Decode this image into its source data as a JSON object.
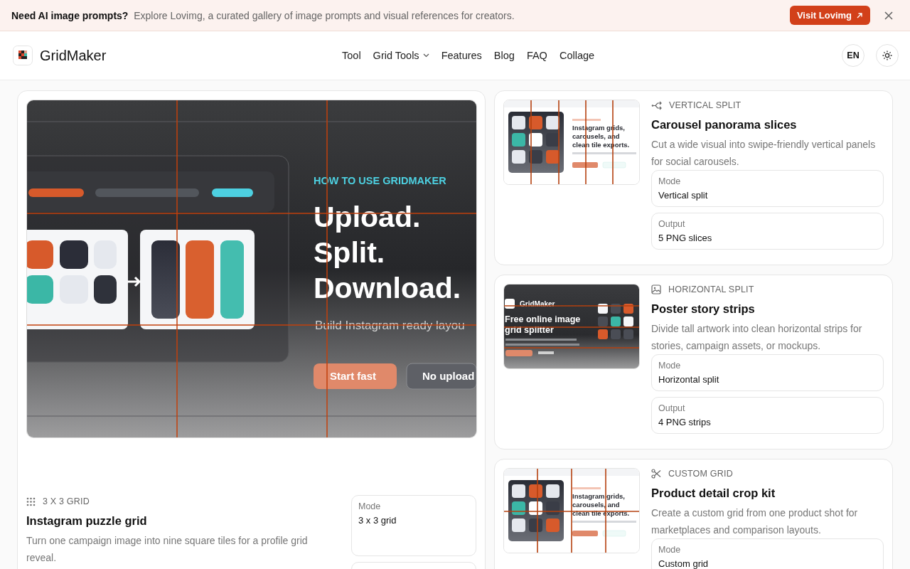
{
  "banner": {
    "title": "Need AI image prompts?",
    "text": "Explore Lovimg, a curated gallery of image prompts and visual references for creators.",
    "button": "Visit Lovimg"
  },
  "header": {
    "brand": "GridMaker",
    "nav": [
      {
        "label": "Tool",
        "dropdown": false
      },
      {
        "label": "Grid Tools",
        "dropdown": true
      },
      {
        "label": "Features",
        "dropdown": false
      },
      {
        "label": "Blog",
        "dropdown": false
      },
      {
        "label": "FAQ",
        "dropdown": false
      },
      {
        "label": "Collage",
        "dropdown": false
      }
    ],
    "language": "EN"
  },
  "featured": {
    "kind": "grid",
    "preview": {
      "eyebrow": "HOW TO USE GRIDMAKER",
      "headline": [
        "Upload.",
        "Split.",
        "Download."
      ],
      "subtitle": "Build Instagram ready layou",
      "buttons": [
        "Start fast",
        "No upload"
      ]
    },
    "category": "3 X 3 GRID",
    "title": "Instagram puzzle grid",
    "description": "Turn one campaign image into nine square tiles for a profile grid reveal.",
    "details": [
      {
        "label": "Mode",
        "value": "3 x 3 grid"
      }
    ]
  },
  "cards": [
    {
      "kind": "vertical",
      "thumbnail": {
        "headline": [
          "Instagram grids,",
          "carousels, and",
          "clean tile exports."
        ]
      },
      "category": "VERTICAL SPLIT",
      "title": "Carousel panorama slices",
      "description": "Cut a wide visual into swipe-friendly vertical panels for social carousels.",
      "details": [
        {
          "label": "Mode",
          "value": "Vertical split"
        },
        {
          "label": "Output",
          "value": "5 PNG slices"
        }
      ]
    },
    {
      "kind": "horizontal",
      "thumbnail": {
        "brand": "GridMaker",
        "headline": [
          "Free online image",
          "grid splitter"
        ]
      },
      "category": "HORIZONTAL SPLIT",
      "title": "Poster story strips",
      "description": "Divide tall artwork into clean horizontal strips for stories, campaign assets, or mockups.",
      "details": [
        {
          "label": "Mode",
          "value": "Horizontal split"
        },
        {
          "label": "Output",
          "value": "4 PNG strips"
        }
      ]
    },
    {
      "kind": "custom",
      "thumbnail": {
        "headline": [
          "Instagram grids,",
          "carousels, and",
          "clean tile exports."
        ]
      },
      "category": "CUSTOM GRID",
      "title": "Product detail crop kit",
      "description": "Create a custom grid from one product shot for marketplaces and comparison layouts.",
      "details": [
        {
          "label": "Mode",
          "value": "Custom grid"
        }
      ]
    }
  ]
}
